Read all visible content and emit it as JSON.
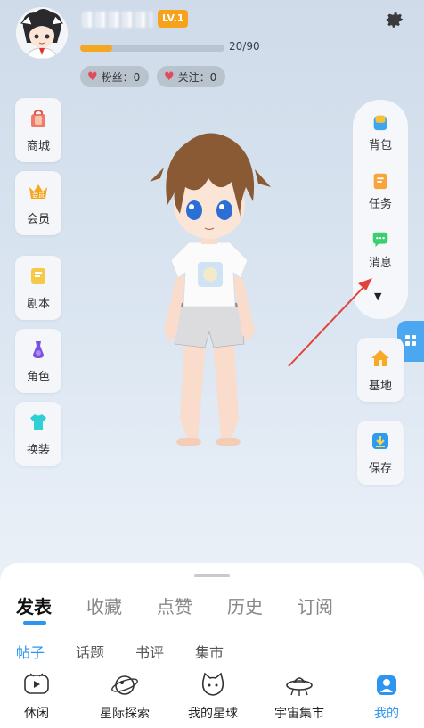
{
  "profile": {
    "level_badge": "LV.1",
    "exp_text": "20/90",
    "exp_progress": 0.222,
    "fans_label": "粉丝：0",
    "follow_label": "关注：0"
  },
  "left_menu": {
    "shop": "商城",
    "vip": "会员",
    "script": "剧本",
    "role": "角色",
    "dress": "换装"
  },
  "right_menu": {
    "backpack": "背包",
    "task": "任务",
    "message": "消息",
    "base": "基地",
    "save": "保存"
  },
  "tabs": [
    "发表",
    "收藏",
    "点赞",
    "历史",
    "订阅"
  ],
  "subtabs": [
    "帖子",
    "话题",
    "书评",
    "集市"
  ],
  "bottom_nav": [
    "休闲",
    "星际探索",
    "我的星球",
    "宇宙集市",
    "我的"
  ],
  "colors": {
    "accent": "#2e95ef",
    "level_badge": "#f6a21b",
    "exp_fill": "#f5a623",
    "arrow": "#e0443a"
  }
}
